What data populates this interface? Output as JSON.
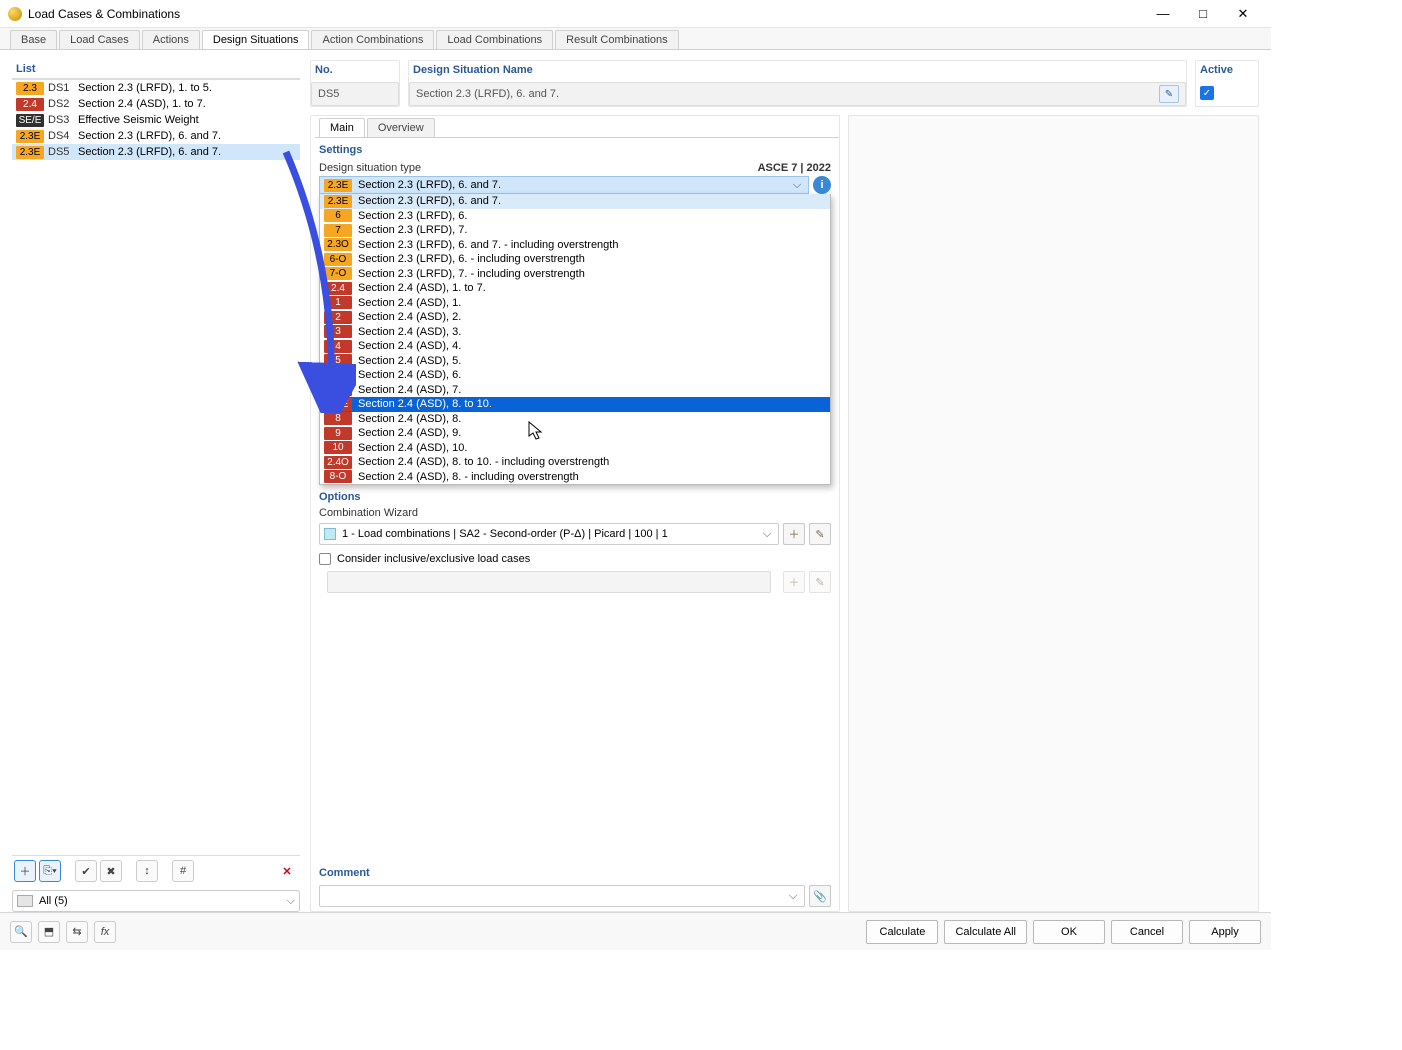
{
  "window": {
    "title": "Load Cases & Combinations"
  },
  "main_tabs": [
    "Base",
    "Load Cases",
    "Actions",
    "Design Situations",
    "Action Combinations",
    "Load Combinations",
    "Result Combinations"
  ],
  "main_tab_active": 3,
  "list": {
    "title": "List",
    "items": [
      {
        "badge": "2.3",
        "bg": "#f5a623",
        "id": "DS1",
        "label": "Section 2.3 (LRFD), 1. to 5."
      },
      {
        "badge": "2.4",
        "bg": "#c0392b",
        "fg": "#fff",
        "id": "DS2",
        "label": "Section 2.4 (ASD), 1. to 7."
      },
      {
        "badge": "SE/E",
        "bg": "#303030",
        "fg": "#fff",
        "id": "DS3",
        "label": "Effective Seismic Weight"
      },
      {
        "badge": "2.3E",
        "bg": "#f5a623",
        "id": "DS4",
        "label": "Section 2.3 (LRFD), 6. and 7."
      },
      {
        "badge": "2.3E",
        "bg": "#f5a623",
        "id": "DS5",
        "label": "Section 2.3 (LRFD), 6. and 7."
      }
    ],
    "selected_index": 4,
    "filter": "All (5)"
  },
  "header": {
    "no_label": "No.",
    "no_value": "DS5",
    "name_label": "Design Situation Name",
    "name_value": "Section 2.3 (LRFD), 6. and 7.",
    "active_label": "Active",
    "active_checked": true
  },
  "inner_tabs": [
    "Main",
    "Overview"
  ],
  "inner_tab_active": 0,
  "settings": {
    "title": "Settings",
    "type_label": "Design situation type",
    "standard": "ASCE 7 | 2022",
    "selected_badge": "2.3E",
    "selected_text": "Section 2.3 (LRFD), 6. and 7.",
    "options": [
      {
        "badge": "2.3E",
        "bg": "#f5a623",
        "label": "Section 2.3 (LRFD), 6. and 7."
      },
      {
        "badge": "6",
        "bg": "#f5a623",
        "label": "Section 2.3 (LRFD), 6."
      },
      {
        "badge": "7",
        "bg": "#f5a623",
        "label": "Section 2.3 (LRFD), 7."
      },
      {
        "badge": "2.3O",
        "bg": "#f5a623",
        "label": "Section 2.3 (LRFD), 6. and 7. - including overstrength"
      },
      {
        "badge": "6-O",
        "bg": "#f5a623",
        "label": "Section 2.3 (LRFD), 6. - including overstrength"
      },
      {
        "badge": "7-O",
        "bg": "#f5a623",
        "label": "Section 2.3 (LRFD), 7. - including overstrength"
      },
      {
        "badge": "2.4",
        "bg": "#c0392b",
        "fg": "#fff",
        "label": "Section 2.4 (ASD), 1. to 7."
      },
      {
        "badge": "1",
        "bg": "#c0392b",
        "fg": "#fff",
        "label": "Section 2.4 (ASD), 1."
      },
      {
        "badge": "2",
        "bg": "#c0392b",
        "fg": "#fff",
        "label": "Section 2.4 (ASD), 2."
      },
      {
        "badge": "3",
        "bg": "#c0392b",
        "fg": "#fff",
        "label": "Section 2.4 (ASD), 3."
      },
      {
        "badge": "4",
        "bg": "#c0392b",
        "fg": "#fff",
        "label": "Section 2.4 (ASD), 4."
      },
      {
        "badge": "5",
        "bg": "#c0392b",
        "fg": "#fff",
        "label": "Section 2.4 (ASD), 5."
      },
      {
        "badge": "6",
        "bg": "#c0392b",
        "fg": "#fff",
        "label": "Section 2.4 (ASD), 6."
      },
      {
        "badge": "7",
        "bg": "#c0392b",
        "fg": "#fff",
        "label": "Section 2.4 (ASD), 7."
      },
      {
        "badge": "2.4E",
        "bg": "#c0392b",
        "fg": "#fff",
        "label": "Section 2.4 (ASD), 8. to 10.",
        "highlight": true
      },
      {
        "badge": "8",
        "bg": "#c0392b",
        "fg": "#fff",
        "label": "Section 2.4 (ASD), 8."
      },
      {
        "badge": "9",
        "bg": "#c0392b",
        "fg": "#fff",
        "label": "Section 2.4 (ASD), 9."
      },
      {
        "badge": "10",
        "bg": "#c0392b",
        "fg": "#fff",
        "label": "Section 2.4 (ASD), 10."
      },
      {
        "badge": "2.4O",
        "bg": "#c0392b",
        "fg": "#fff",
        "label": "Section 2.4 (ASD), 8. to 10. - including overstrength"
      },
      {
        "badge": "8-O",
        "bg": "#c0392b",
        "fg": "#fff",
        "label": "Section 2.4 (ASD), 8. - including overstrength"
      }
    ],
    "options_title": "Options",
    "combo_wizard_label": "Combination Wizard",
    "combo_wizard_value": "1 - Load combinations | SA2 - Second-order (P-Δ) | Picard | 100 | 1",
    "consider_label": "Consider inclusive/exclusive load cases",
    "comment_label": "Comment"
  },
  "footer_buttons": [
    "Calculate",
    "Calculate All",
    "OK",
    "Cancel",
    "Apply"
  ]
}
